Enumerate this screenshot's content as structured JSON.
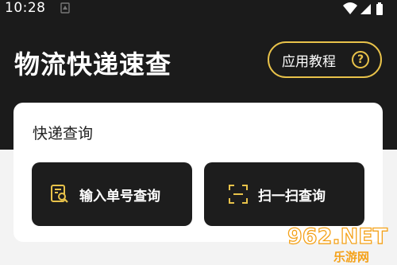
{
  "status_bar": {
    "time": "10:28"
  },
  "header": {
    "title": "物流快递速查",
    "tutorial_label": "应用教程",
    "help_symbol": "?"
  },
  "card": {
    "title": "快递查询",
    "buttons": [
      {
        "label": "输入单号查询",
        "icon": "search-document-icon"
      },
      {
        "label": "扫一扫查询",
        "icon": "scan-icon"
      }
    ]
  },
  "watermark": {
    "brand": "962.NET",
    "subtitle": "乐游网"
  },
  "colors": {
    "header_bg": "#1b1b1b",
    "accent": "#e8c24a",
    "card_bg": "#ffffff",
    "button_bg": "#1d1d1d",
    "page_bg": "#f3f3f3"
  }
}
